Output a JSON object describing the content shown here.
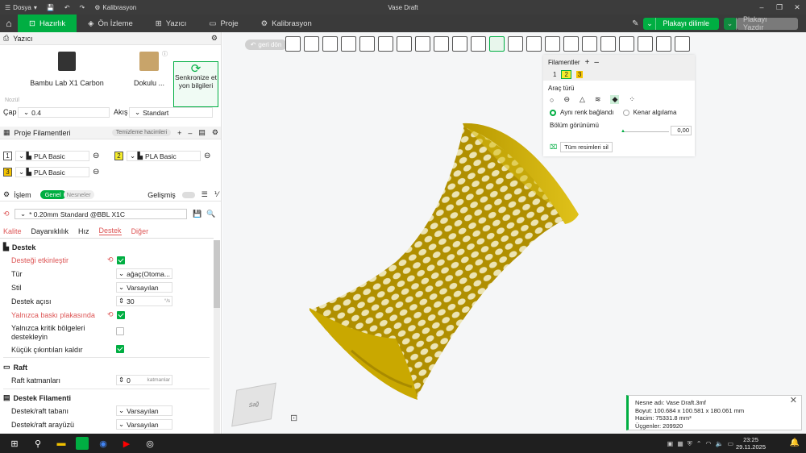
{
  "titlebar": {
    "file": "Dosya",
    "calibration": "Kalibrasyon",
    "title": "Vase Draft"
  },
  "tabs": [
    "Hazırlık",
    "Ön İzleme",
    "Yazıcı",
    "Proje",
    "Kalibrasyon"
  ],
  "actions": {
    "slice": "Plakayı dilimle",
    "print": "Plakayı Yazdır"
  },
  "printer": {
    "header": "Yazıcı",
    "model": "Bambu Lab X1 Carbon",
    "plate": "Dokulu ...",
    "sync": "Senkronize et",
    "sync2": "yon bilgileri",
    "nozzle_label": "Nozül",
    "diameter_label": "Çap",
    "diameter": "0.4",
    "flow_label": "Akış",
    "flow": "Standart"
  },
  "filaments": {
    "header": "Proje Filamentleri",
    "clean_btn": "Temizleme hacimleri",
    "items": [
      {
        "num": "1",
        "name": "PLA Basic",
        "color": "#ffffff"
      },
      {
        "num": "2",
        "name": "PLA Basic",
        "color": "#f5ec2b"
      },
      {
        "num": "3",
        "name": "PLA Basic",
        "color": "#f5c400"
      }
    ]
  },
  "process": {
    "header": "İşlem",
    "tab_general": "Genel",
    "tab_objects": "Nesneler",
    "advanced": "Gelişmiş",
    "preset": "* 0.20mm Standard @BBL X1C"
  },
  "subtabs": [
    "Kalite",
    "Dayanıklılık",
    "Hız",
    "Destek",
    "Diğer"
  ],
  "support": {
    "section": "Destek",
    "enable": "Desteği etkinleştir",
    "type_label": "Tür",
    "type_val": "ağaç(Otoma...",
    "style_label": "Stil",
    "style_val": "Varsayılan",
    "angle_label": "Destek açısı",
    "angle_val": "30",
    "angle_unit": "°/s",
    "plate_only": "Yalnızca baskı plakasında",
    "critical": "Yalnızca kritik bölgeleri",
    "critical2": "destekleyin",
    "remove_small": "Küçük çıkıntıları kaldır",
    "raft_section": "Raft",
    "raft_layers_label": "Raft katmanları",
    "raft_layers_val": "0",
    "raft_unit": "katmanlar",
    "fil_section": "Destek Filamenti",
    "base_label": "Destek/raft tabanı",
    "base_val": "Varsayılan",
    "iface_label": "Destek/raft arayüzü",
    "iface_val": "Varsayılan"
  },
  "viewport": {
    "back": "geri dön",
    "cube_label": "Sağ"
  },
  "fpanel": {
    "title": "Filamentler",
    "nums": [
      "1",
      "2",
      "3"
    ],
    "tool_label": "Araç türü",
    "opt1": "Aynı renk bağlandı",
    "opt2": "Kenar algılama",
    "section_label": "Bölüm görünümü",
    "section_val": "0,00",
    "clear": "Tüm resimleri sil"
  },
  "notif": {
    "name": "Nesne adı: Vase Draft.3mf",
    "size": "Boyut: 100.684 x 100.581 x 180.061 mm",
    "volume": "Hacim: 75331.8 mm³",
    "triangles": "Üçgenler: 209920"
  },
  "taskbar": {
    "time": "23:25",
    "date": "29.11.2025"
  },
  "colors": {
    "accent": "#00ae42",
    "vase": "#c9a800"
  }
}
